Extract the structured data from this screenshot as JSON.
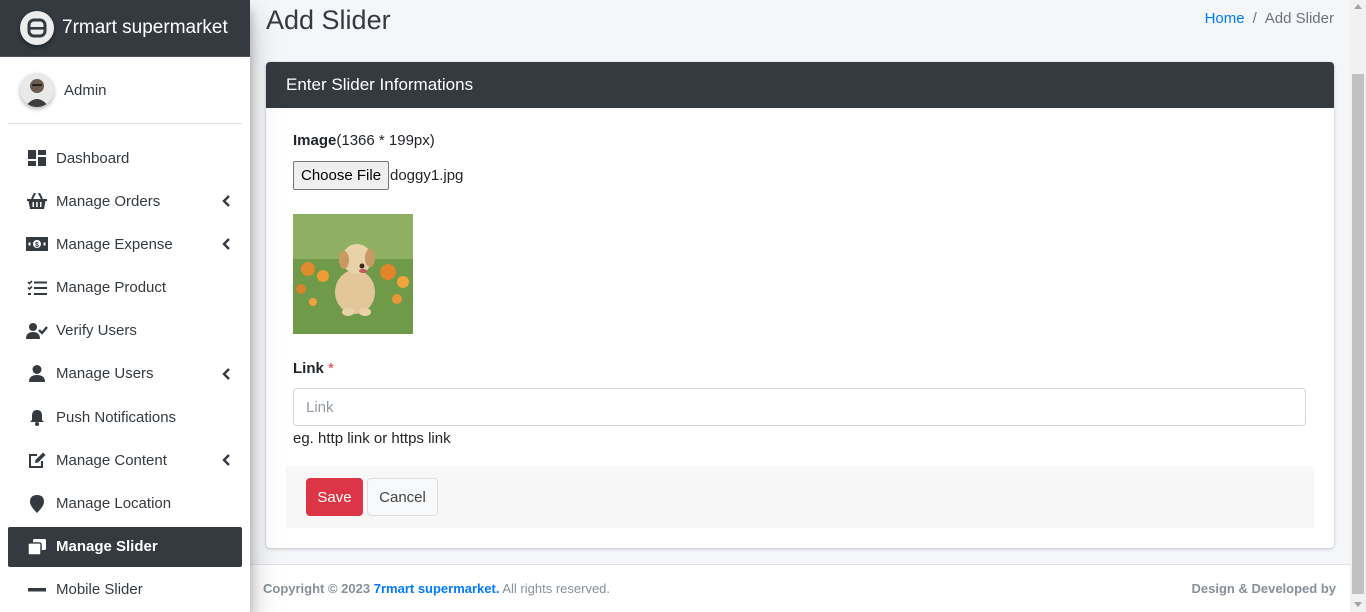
{
  "app": {
    "brand": "7rmart supermarket"
  },
  "user": {
    "name": "Admin"
  },
  "sidebar": {
    "items": [
      {
        "label": "Dashboard",
        "icon": "dashboard-icon",
        "has_children": false,
        "active": false
      },
      {
        "label": "Manage Orders",
        "icon": "basket-icon",
        "has_children": true,
        "active": false
      },
      {
        "label": "Manage Expense",
        "icon": "money-icon",
        "has_children": true,
        "active": false
      },
      {
        "label": "Manage Product",
        "icon": "tasks-list-icon",
        "has_children": false,
        "active": false
      },
      {
        "label": "Verify Users",
        "icon": "user-check-icon",
        "has_children": false,
        "active": false
      },
      {
        "label": "Manage Users",
        "icon": "user-icon",
        "has_children": true,
        "active": false
      },
      {
        "label": "Push Notifications",
        "icon": "bell-icon",
        "has_children": false,
        "active": false
      },
      {
        "label": "Manage Content",
        "icon": "edit-icon",
        "has_children": true,
        "active": false
      },
      {
        "label": "Manage Location",
        "icon": "map-pin-icon",
        "has_children": false,
        "active": false
      },
      {
        "label": "Manage Slider",
        "icon": "window-restore-icon",
        "has_children": false,
        "active": true
      },
      {
        "label": "Mobile Slider",
        "icon": "minus-icon",
        "has_children": false,
        "active": false
      }
    ]
  },
  "page": {
    "title": "Add Slider",
    "breadcrumb": {
      "home": "Home",
      "separator": "/",
      "current": "Add Slider"
    }
  },
  "form": {
    "header": "Enter Slider Informations",
    "image_label": "Image",
    "image_hint": "(1366 * 199px)",
    "choose_file_label": "Choose File",
    "file_name": "doggy1.jpg",
    "link_label": "Link",
    "required_mark": "*",
    "link_placeholder": "Link",
    "link_value": "",
    "link_help": "eg. http link or https link",
    "save_label": "Save",
    "cancel_label": "Cancel"
  },
  "footer": {
    "copyright_prefix": "Copyright © 2023",
    "brand": "7rmart supermarket.",
    "rights": "All rights reserved.",
    "credit": "Design & Developed by"
  },
  "colors": {
    "dark": "#343a40",
    "primary": "#007bff",
    "danger": "#dc3545",
    "background": "#f4f6f9"
  }
}
